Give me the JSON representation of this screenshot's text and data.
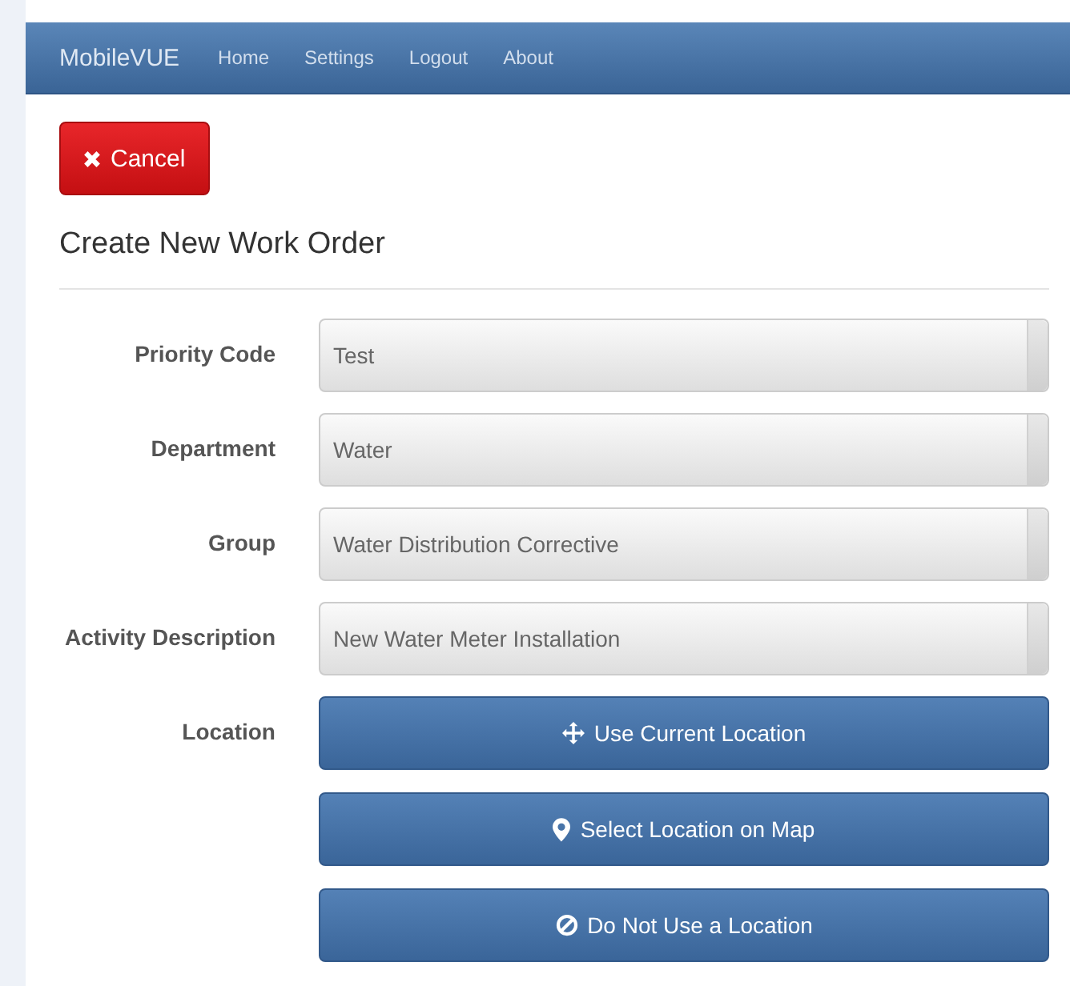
{
  "navbar": {
    "brand": "MobileVUE",
    "links": [
      "Home",
      "Settings",
      "Logout",
      "About"
    ]
  },
  "cancel_button": {
    "label": "Cancel"
  },
  "title": "Create New Work Order",
  "fields": [
    {
      "label": "Priority Code",
      "value": "Test"
    },
    {
      "label": "Department",
      "value": "Water"
    },
    {
      "label": "Group",
      "value": "Water Distribution Corrective"
    },
    {
      "label": "Activity Description",
      "value": "New Water Meter Installation"
    }
  ],
  "location": {
    "label": "Location",
    "buttons": [
      {
        "kind": "move",
        "label": "Use Current Location"
      },
      {
        "kind": "pin",
        "label": "Select Location on Map"
      },
      {
        "kind": "ban",
        "label": "Do Not Use a Location"
      }
    ]
  }
}
